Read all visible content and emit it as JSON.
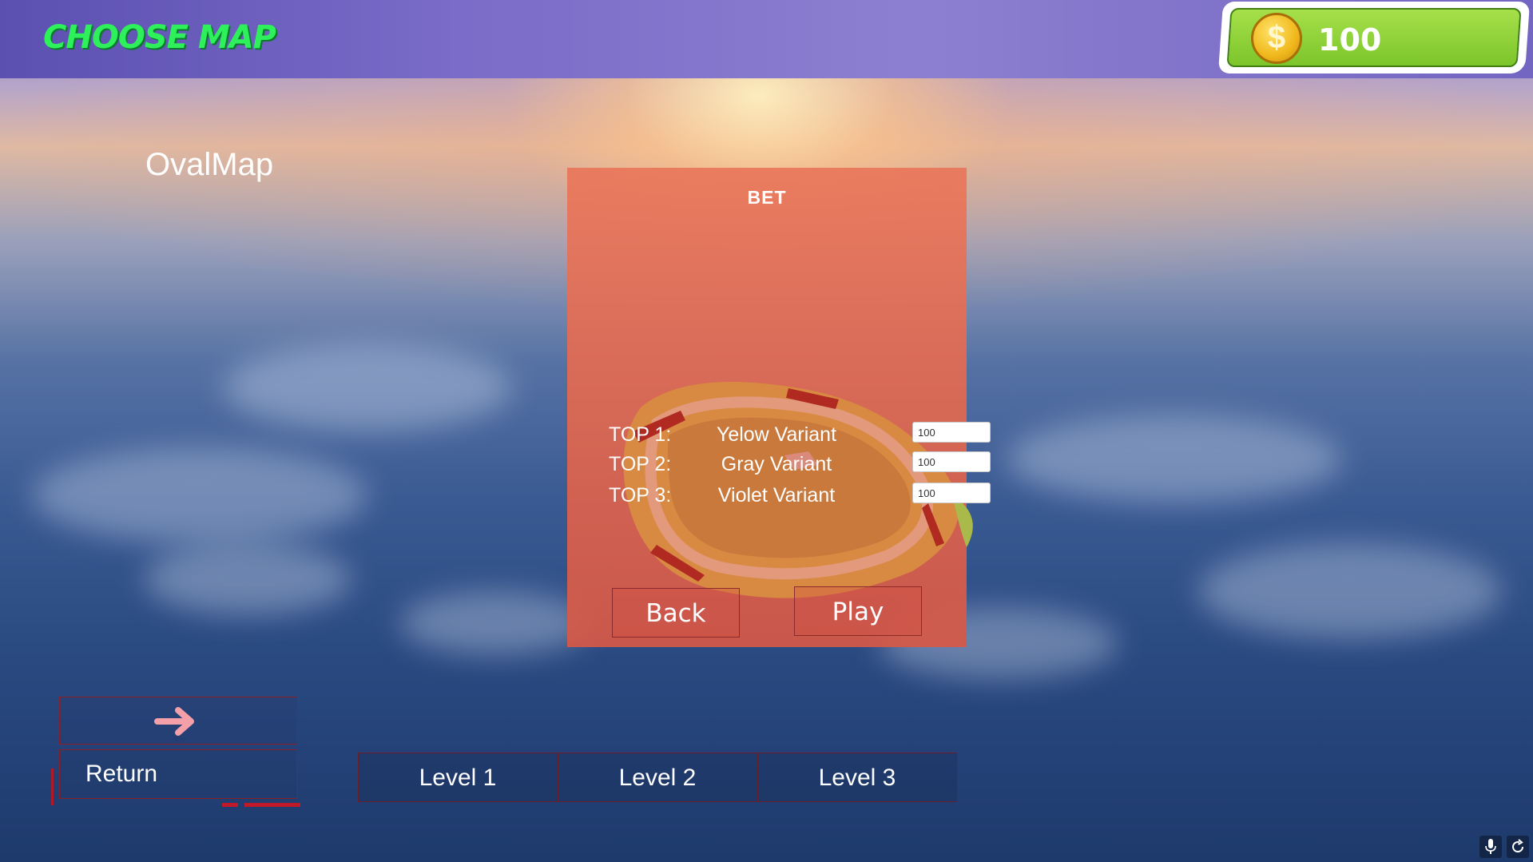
{
  "header": {
    "title": "CHOOSE MAP"
  },
  "coins": {
    "value": "100",
    "icon": "dollar-coin-icon",
    "symbol": "$"
  },
  "map": {
    "name": "OvalMap"
  },
  "bet_panel": {
    "title": "BET",
    "rows": [
      {
        "rank": "TOP 1:",
        "variant": "Yelow Variant",
        "bet": "100"
      },
      {
        "rank": "TOP 2:",
        "variant": "Gray Variant",
        "bet": "100"
      },
      {
        "rank": "TOP 3:",
        "variant": "Violet Variant",
        "bet": "100"
      }
    ],
    "back_label": "Back",
    "play_label": "Play"
  },
  "navigation": {
    "next_icon": "arrow-right-icon",
    "return_label": "Return"
  },
  "levels": [
    "Level 1",
    "Level 2",
    "Level 3"
  ],
  "corner_icons": [
    "microphone-icon",
    "refresh-icon"
  ],
  "colors": {
    "title_green": "#2ef05a",
    "coin_panel_green": "#8fd43a",
    "bet_panel": "#e07a5e",
    "arrow_pink": "#f4a0a8",
    "button_border_red": "#8a1f28"
  }
}
